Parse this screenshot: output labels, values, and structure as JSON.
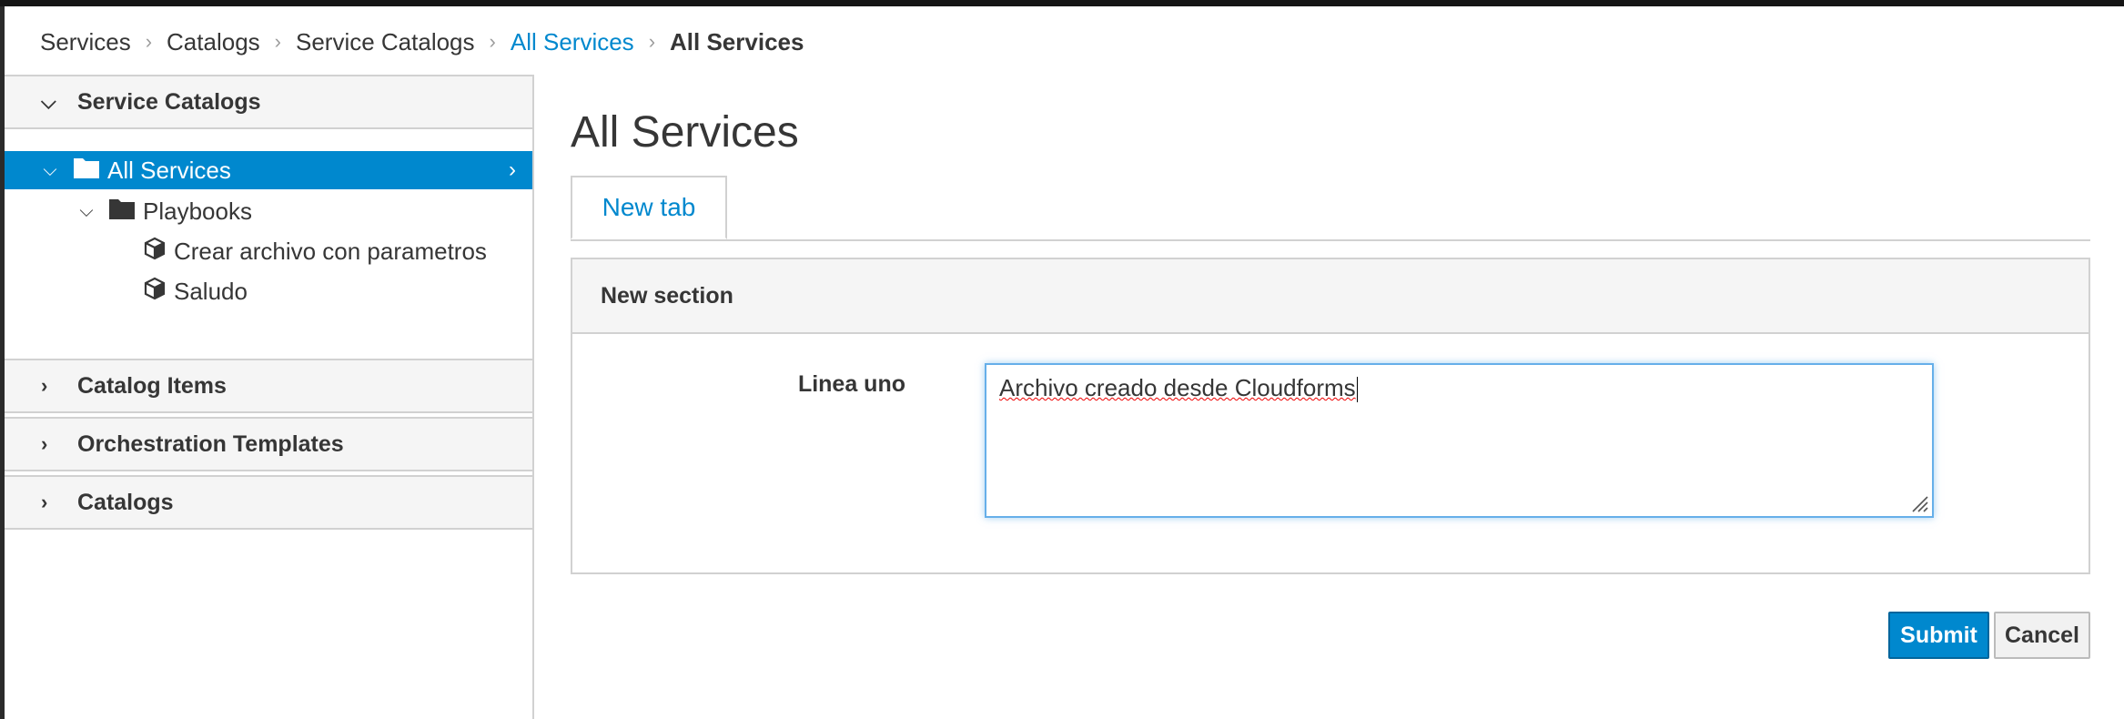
{
  "breadcrumb": {
    "items": [
      {
        "label": "Services"
      },
      {
        "label": "Catalogs"
      },
      {
        "label": "Service Catalogs"
      },
      {
        "label": "All Services"
      },
      {
        "label": "All Services"
      }
    ]
  },
  "sidebar": {
    "sections": [
      {
        "label": "Service Catalogs",
        "expanded": true
      },
      {
        "label": "Catalog Items",
        "expanded": false
      },
      {
        "label": "Orchestration Templates",
        "expanded": false
      },
      {
        "label": "Catalogs",
        "expanded": false
      }
    ],
    "tree": [
      {
        "label": "All Services",
        "selected": true,
        "icon": "folder-icon"
      },
      {
        "label": "Playbooks",
        "icon": "folder-icon"
      },
      {
        "label": "Crear archivo con parametros",
        "icon": "cube-icon"
      },
      {
        "label": "Saludo",
        "icon": "cube-icon"
      }
    ]
  },
  "main": {
    "title": "All Services",
    "tabs": [
      {
        "label": "New tab",
        "active": true
      }
    ],
    "section": {
      "title": "New section",
      "field_label": "Linea uno",
      "field_value": "Archivo creado desde Cloudforms"
    }
  },
  "buttons": {
    "submit": "Submit",
    "cancel": "Cancel"
  },
  "colors": {
    "accent": "#0088ce",
    "selected_bg": "#0088ce",
    "header_bg": "#f5f5f5",
    "focus_border": "#66afe9"
  }
}
